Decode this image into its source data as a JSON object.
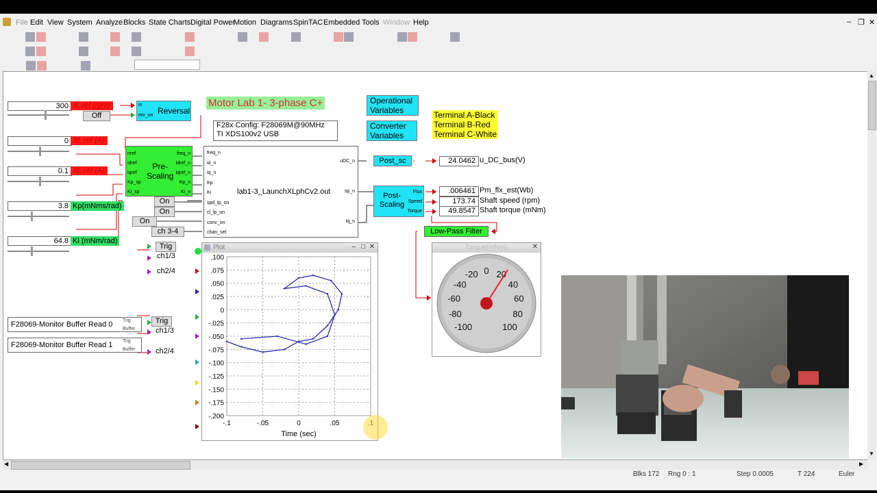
{
  "menu": [
    "File",
    "Edit",
    "View",
    "System",
    "Analyze",
    "Blocks",
    "State Charts",
    "Digital Power",
    "Motion",
    "Diagrams",
    "SpinTAC",
    "Embedded",
    "Tools",
    "Window",
    "Help"
  ],
  "diagram": {
    "title": "Motor Lab 1- 3-phase C+",
    "config_line1": "F28x Config: F28069M@90MHz",
    "config_line2": "TI XDS100v2 USB",
    "op_vars": "Operational Variables",
    "conv_vars": "Converter Variables",
    "terminal_a": "Terminal A-Black",
    "terminal_b": "Terminal B-Red",
    "terminal_c": "Terminal C-White",
    "inputs": [
      {
        "value": "300",
        "label": "n_ref (rpm)"
      },
      {
        "value": "0",
        "label": "Id_ref (A)"
      },
      {
        "value": "0.1",
        "label": "Iq_ref (A)"
      },
      {
        "value": "3.8",
        "label": "Kp(mNms/rad)"
      },
      {
        "value": "64.8",
        "label": "Ki (mNm/rad)"
      }
    ],
    "off_button": "Off",
    "reversal": "Reversal",
    "reversal_in": "in",
    "reversal_out": "rev_on",
    "prescaling": "Pre-\nScaling",
    "prescaling_in": [
      "nref",
      "idref",
      "iqref",
      "Kp_sp",
      "Ki_sp"
    ],
    "prescaling_out": [
      "freq_n",
      "idref_n",
      "iqref_n",
      "Kp_n",
      "Ki_n"
    ],
    "launch_block": "lab1-3_LaunchXLphCv2.out",
    "launch_in": [
      "freq_n",
      "id_n",
      "iq_n",
      "Kp",
      "Ki",
      "spd_lp_on",
      "cl_lp_on",
      "conv_on",
      "chan_sel"
    ],
    "launch_out": [
      "uDC_n",
      "sp_n",
      "iq_n"
    ],
    "on1": "On",
    "on2": "On",
    "on3": "On",
    "channel": "ch 3-4",
    "post_sc": "Post_sc",
    "post_scaling": "Post-\nScaling",
    "post_scaling_out": [
      "Flux",
      "Speed",
      "Torque"
    ],
    "dc_bus_value": "24.0462",
    "dc_bus_label": "u_DC_bus(V)",
    "flux_value": ".006461",
    "flux_label": "Pm_flx_est(Wb)",
    "speed_value": "173.74",
    "speed_label": "Shaft speed (rpm)",
    "torque_value": "49.8547",
    "torque_label": "Shaft torque (mNm)",
    "lowpass": "Low-Pass Filter",
    "trig": "Trig",
    "ch13": "ch1/3",
    "ch24": "ch2/4",
    "monitor0": "F28069-Monitor Buffer Read 0",
    "monitor1": "F28069-Monitor Buffer Read 1",
    "mon_ports": [
      "Trig",
      "Buffer"
    ]
  },
  "plot": {
    "title": "Plot",
    "xlabel": "Time (sec)",
    "yticks": [
      ".100",
      ".075",
      ".050",
      ".025",
      "0",
      "-.025",
      "-.050",
      "-.075",
      "-.100",
      "-.125",
      "-.150",
      "-.175",
      "-.200"
    ],
    "xticks": [
      "-.1",
      "-.05",
      "0",
      ".05",
      ".1"
    ]
  },
  "gauge": {
    "title": "Torque(mNm)",
    "ticks": [
      "-20",
      "0",
      "20",
      "-40",
      "40",
      "-60",
      "60",
      "-80",
      "80",
      "-100",
      "100"
    ],
    "value_fraction": 0.62
  },
  "status": {
    "blks": "Blks 172",
    "rng": "Rng 0 : 1",
    "step": "Step 0.0005",
    "time": "T 224",
    "method": "Euler"
  },
  "chart_data": {
    "type": "scatter",
    "title": "",
    "xlabel": "Time (sec)",
    "ylabel": "",
    "xlim": [
      -0.1,
      0.1
    ],
    "ylim": [
      -0.2,
      0.1
    ],
    "series": [
      {
        "values": [
          [
            -0.1,
            -0.06
          ],
          [
            -0.08,
            -0.07
          ],
          [
            -0.05,
            -0.08
          ],
          [
            -0.02,
            -0.075
          ],
          [
            0.0,
            -0.06
          ],
          [
            0.02,
            -0.055
          ],
          [
            0.04,
            -0.03
          ],
          [
            0.055,
            0.0
          ],
          [
            0.06,
            0.03
          ],
          [
            0.045,
            0.055
          ],
          [
            0.02,
            0.065
          ],
          [
            0.0,
            0.06
          ],
          [
            -0.02,
            0.04
          ],
          [
            0.01,
            0.045
          ],
          [
            0.04,
            0.03
          ],
          [
            0.05,
            -0.01
          ],
          [
            0.04,
            -0.05
          ],
          [
            0.01,
            -0.065
          ],
          [
            -0.03,
            -0.05
          ],
          [
            -0.08,
            -0.055
          ]
        ]
      }
    ]
  }
}
